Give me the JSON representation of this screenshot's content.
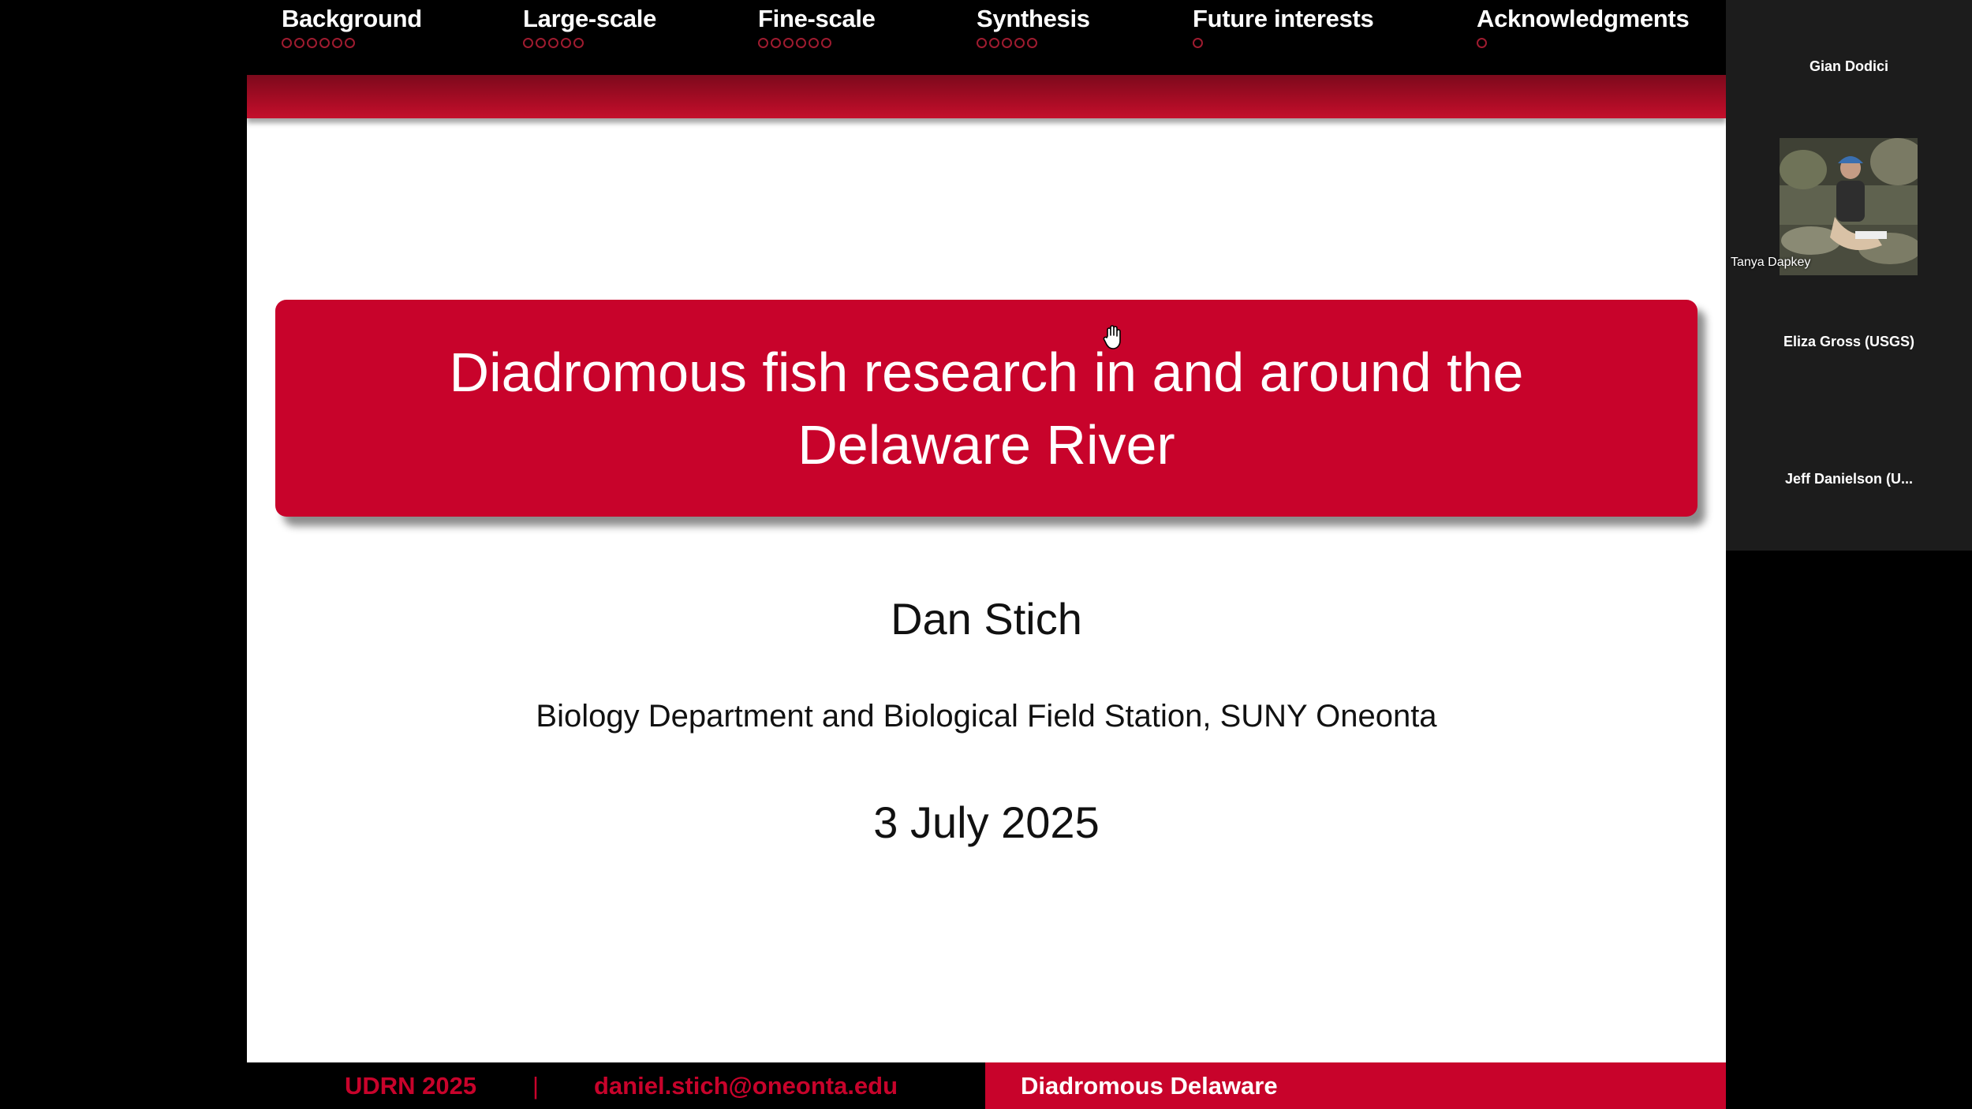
{
  "nav": {
    "items": [
      {
        "label": "Background",
        "dots": 6
      },
      {
        "label": "Large-scale",
        "dots": 5
      },
      {
        "label": "Fine-scale",
        "dots": 6
      },
      {
        "label": "Synthesis",
        "dots": 5
      },
      {
        "label": "Future interests",
        "dots": 1
      },
      {
        "label": "Acknowledgments",
        "dots": 1
      }
    ]
  },
  "slide": {
    "title": "Diadromous fish research in and around the Delaware River",
    "author": "Dan Stich",
    "affiliation": "Biology Department and Biological Field Station, SUNY Oneonta",
    "date": "3 July 2025"
  },
  "footer": {
    "event": "UDRN 2025",
    "separator": "|",
    "email": "daniel.stich@oneonta.edu",
    "short_title": "Diadromous Delaware"
  },
  "participants": [
    {
      "name": "Gian Dodici",
      "has_video": false
    },
    {
      "name": "Tanya Dapkey",
      "has_video": true
    },
    {
      "name": "Eliza Gross (USGS)",
      "has_video": false
    },
    {
      "name": "Jeff Danielson (U...",
      "has_video": false
    }
  ],
  "colors": {
    "accent": "#c8032b",
    "nav_bg": "#000000",
    "panel_bg": "#1c1c1c"
  },
  "icons": {
    "cursor": "hand-cursor-icon"
  }
}
